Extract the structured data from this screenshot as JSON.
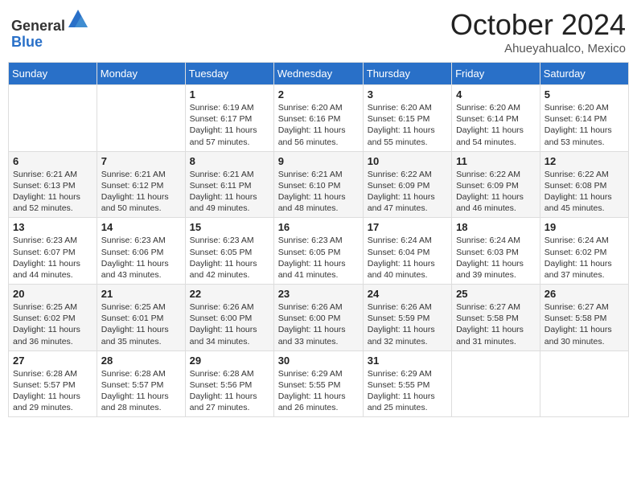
{
  "header": {
    "logo_general": "General",
    "logo_blue": "Blue",
    "month_title": "October 2024",
    "location": "Ahueyahualco, Mexico"
  },
  "days_of_week": [
    "Sunday",
    "Monday",
    "Tuesday",
    "Wednesday",
    "Thursday",
    "Friday",
    "Saturday"
  ],
  "weeks": [
    [
      {
        "day": "",
        "info": ""
      },
      {
        "day": "",
        "info": ""
      },
      {
        "day": "1",
        "info": "Sunrise: 6:19 AM\nSunset: 6:17 PM\nDaylight: 11 hours and 57 minutes."
      },
      {
        "day": "2",
        "info": "Sunrise: 6:20 AM\nSunset: 6:16 PM\nDaylight: 11 hours and 56 minutes."
      },
      {
        "day": "3",
        "info": "Sunrise: 6:20 AM\nSunset: 6:15 PM\nDaylight: 11 hours and 55 minutes."
      },
      {
        "day": "4",
        "info": "Sunrise: 6:20 AM\nSunset: 6:14 PM\nDaylight: 11 hours and 54 minutes."
      },
      {
        "day": "5",
        "info": "Sunrise: 6:20 AM\nSunset: 6:14 PM\nDaylight: 11 hours and 53 minutes."
      }
    ],
    [
      {
        "day": "6",
        "info": "Sunrise: 6:21 AM\nSunset: 6:13 PM\nDaylight: 11 hours and 52 minutes."
      },
      {
        "day": "7",
        "info": "Sunrise: 6:21 AM\nSunset: 6:12 PM\nDaylight: 11 hours and 50 minutes."
      },
      {
        "day": "8",
        "info": "Sunrise: 6:21 AM\nSunset: 6:11 PM\nDaylight: 11 hours and 49 minutes."
      },
      {
        "day": "9",
        "info": "Sunrise: 6:21 AM\nSunset: 6:10 PM\nDaylight: 11 hours and 48 minutes."
      },
      {
        "day": "10",
        "info": "Sunrise: 6:22 AM\nSunset: 6:09 PM\nDaylight: 11 hours and 47 minutes."
      },
      {
        "day": "11",
        "info": "Sunrise: 6:22 AM\nSunset: 6:09 PM\nDaylight: 11 hours and 46 minutes."
      },
      {
        "day": "12",
        "info": "Sunrise: 6:22 AM\nSunset: 6:08 PM\nDaylight: 11 hours and 45 minutes."
      }
    ],
    [
      {
        "day": "13",
        "info": "Sunrise: 6:23 AM\nSunset: 6:07 PM\nDaylight: 11 hours and 44 minutes."
      },
      {
        "day": "14",
        "info": "Sunrise: 6:23 AM\nSunset: 6:06 PM\nDaylight: 11 hours and 43 minutes."
      },
      {
        "day": "15",
        "info": "Sunrise: 6:23 AM\nSunset: 6:05 PM\nDaylight: 11 hours and 42 minutes."
      },
      {
        "day": "16",
        "info": "Sunrise: 6:23 AM\nSunset: 6:05 PM\nDaylight: 11 hours and 41 minutes."
      },
      {
        "day": "17",
        "info": "Sunrise: 6:24 AM\nSunset: 6:04 PM\nDaylight: 11 hours and 40 minutes."
      },
      {
        "day": "18",
        "info": "Sunrise: 6:24 AM\nSunset: 6:03 PM\nDaylight: 11 hours and 39 minutes."
      },
      {
        "day": "19",
        "info": "Sunrise: 6:24 AM\nSunset: 6:02 PM\nDaylight: 11 hours and 37 minutes."
      }
    ],
    [
      {
        "day": "20",
        "info": "Sunrise: 6:25 AM\nSunset: 6:02 PM\nDaylight: 11 hours and 36 minutes."
      },
      {
        "day": "21",
        "info": "Sunrise: 6:25 AM\nSunset: 6:01 PM\nDaylight: 11 hours and 35 minutes."
      },
      {
        "day": "22",
        "info": "Sunrise: 6:26 AM\nSunset: 6:00 PM\nDaylight: 11 hours and 34 minutes."
      },
      {
        "day": "23",
        "info": "Sunrise: 6:26 AM\nSunset: 6:00 PM\nDaylight: 11 hours and 33 minutes."
      },
      {
        "day": "24",
        "info": "Sunrise: 6:26 AM\nSunset: 5:59 PM\nDaylight: 11 hours and 32 minutes."
      },
      {
        "day": "25",
        "info": "Sunrise: 6:27 AM\nSunset: 5:58 PM\nDaylight: 11 hours and 31 minutes."
      },
      {
        "day": "26",
        "info": "Sunrise: 6:27 AM\nSunset: 5:58 PM\nDaylight: 11 hours and 30 minutes."
      }
    ],
    [
      {
        "day": "27",
        "info": "Sunrise: 6:28 AM\nSunset: 5:57 PM\nDaylight: 11 hours and 29 minutes."
      },
      {
        "day": "28",
        "info": "Sunrise: 6:28 AM\nSunset: 5:57 PM\nDaylight: 11 hours and 28 minutes."
      },
      {
        "day": "29",
        "info": "Sunrise: 6:28 AM\nSunset: 5:56 PM\nDaylight: 11 hours and 27 minutes."
      },
      {
        "day": "30",
        "info": "Sunrise: 6:29 AM\nSunset: 5:55 PM\nDaylight: 11 hours and 26 minutes."
      },
      {
        "day": "31",
        "info": "Sunrise: 6:29 AM\nSunset: 5:55 PM\nDaylight: 11 hours and 25 minutes."
      },
      {
        "day": "",
        "info": ""
      },
      {
        "day": "",
        "info": ""
      }
    ]
  ]
}
